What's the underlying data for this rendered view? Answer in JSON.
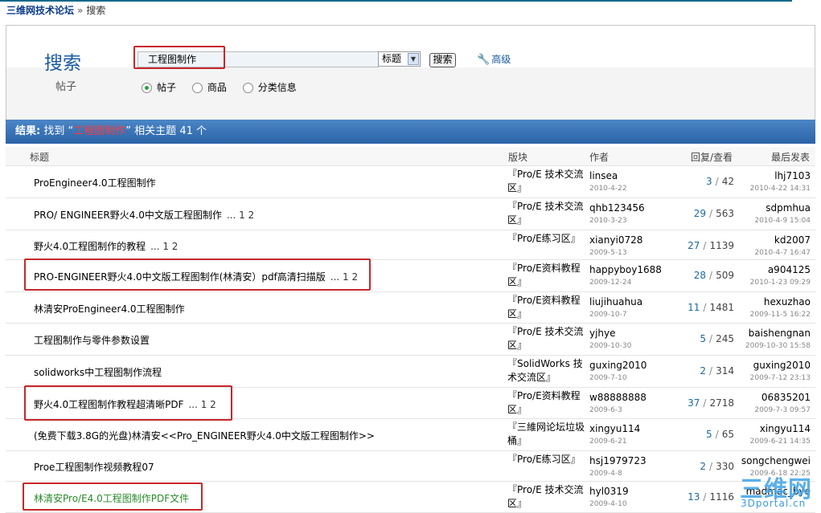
{
  "breadcrumb": {
    "home": "三维网技术论坛",
    "sep": "»",
    "current": "搜索"
  },
  "search": {
    "heading": "搜索",
    "subheading": "帖子",
    "query": "工程图制作",
    "scope_value": "标题",
    "button": "搜索",
    "advanced": "高级",
    "types": [
      {
        "label": "帖子",
        "checked": true
      },
      {
        "label": "商品",
        "checked": false
      },
      {
        "label": "分类信息",
        "checked": false
      }
    ]
  },
  "result": {
    "label": "结果:",
    "prefix": "找到",
    "quote_open": "“",
    "keyword": "工程图制作",
    "quote_close": "”",
    "mid": "相关主题",
    "count": "41",
    "unit": "个"
  },
  "columns": {
    "title": "标题",
    "forum": "版块",
    "author": "作者",
    "stats": "回复/查看",
    "last": "最后发表"
  },
  "rows": [
    {
      "title": "ProEngineer4.0工程图制作",
      "pages": "",
      "forum": "『Pro/E 技术交流区』",
      "author": "linsea",
      "adate": "2010-4-22",
      "replies": "3",
      "views": "42",
      "last_user": "lhj7103",
      "last_date": "2010-4-22 14:31"
    },
    {
      "title": "PRO/ ENGINEER野火4.0中文版工程图制作",
      "pages": "... 1 2",
      "forum": "『Pro/E 技术交流区』",
      "author": "qhb123456",
      "adate": "2010-3-23",
      "replies": "29",
      "views": "563",
      "last_user": "sdpmhua",
      "last_date": "2010-4-9 15:04"
    },
    {
      "title": "野火4.0工程图制作的教程",
      "pages": "... 1 2",
      "forum": "『Pro/E练习区』",
      "author": "xianyi0728",
      "adate": "2009-5-13",
      "replies": "27",
      "views": "1139",
      "last_user": "kd2007",
      "last_date": "2010-4-7 16:47"
    },
    {
      "title": "PRO-ENGINEER野火4.0中文版工程图制作(林清安）pdf高清扫描版",
      "pages": "... 1 2",
      "forum": "『Pro/E资料教程区』",
      "author": "happyboy1688",
      "adate": "2009-12-24",
      "replies": "28",
      "views": "509",
      "last_user": "a904125",
      "last_date": "2010-1-23 09:29"
    },
    {
      "title": "林清安ProEngineer4.0工程图制作",
      "pages": "",
      "forum": "『Pro/E资料教程区』",
      "author": "liujihuahua",
      "adate": "2009-10-7",
      "replies": "11",
      "views": "1481",
      "last_user": "hexuzhao",
      "last_date": "2009-11-5 16:22"
    },
    {
      "title": "工程图制作与零件参数设置",
      "pages": "",
      "forum": "『Pro/E 技术交流区』",
      "author": "yjhye",
      "adate": "2009-10-30",
      "replies": "5",
      "views": "245",
      "last_user": "baishengnan",
      "last_date": "2009-10-30 15:58"
    },
    {
      "title": "solidworks中工程图制作流程",
      "pages": "",
      "forum": "『SolidWorks 技术交流区』",
      "author": "guxing2010",
      "adate": "2009-7-10",
      "replies": "2",
      "views": "314",
      "last_user": "guxing2010",
      "last_date": "2009-7-12 23:13"
    },
    {
      "title": "野火4.0工程图制作教程超清晰PDF",
      "pages": "... 1 2",
      "forum": "『Pro/E资料教程区』",
      "author": "w88888888",
      "adate": "2009-6-3",
      "replies": "37",
      "views": "2718",
      "last_user": "06835201",
      "last_date": "2009-7-3 09:57"
    },
    {
      "title": "(免费下载3.8G的光盘)林清安<<Pro_ENGINEER野火4.0中文版工程图制作>>",
      "pages": "",
      "forum": "『三維网论坛垃圾桶』",
      "author": "xingyu114",
      "adate": "2009-6-21",
      "replies": "5",
      "views": "65",
      "last_user": "xingyu114",
      "last_date": "2009-6-21 14:35"
    },
    {
      "title": "Proe工程图制作视频教程07",
      "pages": "",
      "forum": "『Pro/E练习区』",
      "author": "hsj1979723",
      "adate": "2009-4-8",
      "replies": "2",
      "views": "330",
      "last_user": "songchengwei",
      "last_date": "2009-6-18 22:25"
    },
    {
      "title": "林清安Pro/E4.0工程图制作PDF文件",
      "pages": "",
      "forum": "『Pro/E 技术交流区』",
      "author": "hyl0319",
      "adate": "2009-4-10",
      "replies": "13",
      "views": "1116",
      "last_user": "madmac_bye",
      "last_date": ""
    }
  ],
  "watermark": {
    "big": "三维网",
    "small": "3Dportal.cn"
  }
}
